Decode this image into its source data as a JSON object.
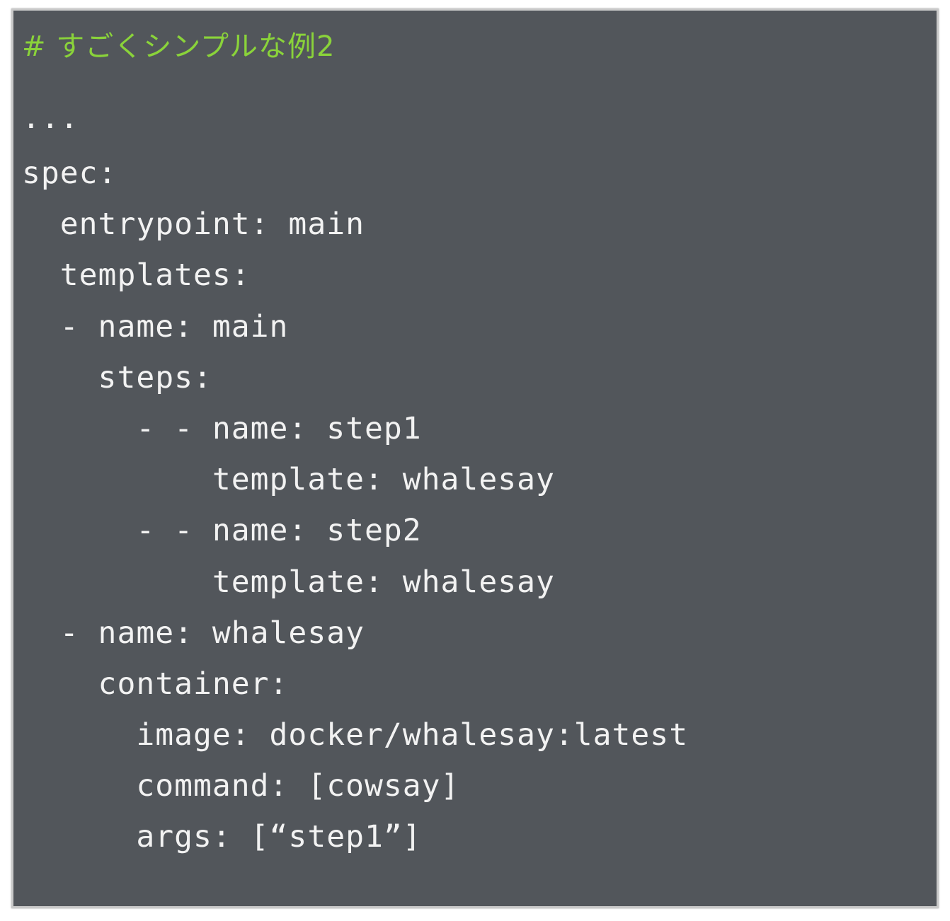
{
  "code": {
    "comment": "# すごくシンプルな例2",
    "lines": [
      "...",
      "spec:",
      "  entrypoint: main",
      "  templates:",
      "  - name: main",
      "    steps:",
      "      - - name: step1",
      "          template: whalesay",
      "      - - name: step2",
      "          template: whalesay",
      "  - name: whalesay",
      "    container:",
      "      image: docker/whalesay:latest",
      "      command: [cowsay]",
      "      args: [“step1”]"
    ]
  }
}
